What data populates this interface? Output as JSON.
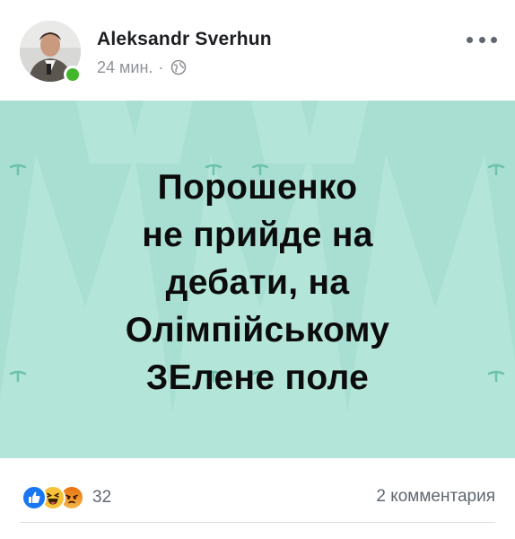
{
  "post": {
    "author": {
      "name": "Aleksandr Sverhun",
      "online": true
    },
    "meta": {
      "time": "24 мин.",
      "separator": "·",
      "privacy_icon": "globe-icon"
    },
    "more_icon": "more-horizontal-icon",
    "image": {
      "background_color": "#a9dfd2",
      "text_lines": [
        "Порошенко",
        "не прийде на",
        "дебати, на",
        "Олімпійському",
        "ЗЕлене поле"
      ]
    },
    "reactions": {
      "icons": [
        "like-icon",
        "haha-icon",
        "angry-icon"
      ],
      "count": "32"
    },
    "comments_label": "2 комментария"
  }
}
